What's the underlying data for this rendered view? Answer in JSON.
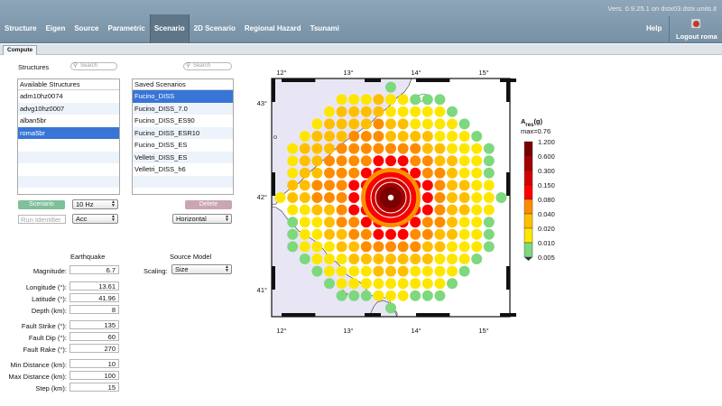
{
  "header": {
    "version": "Vers. 0.9.25.1 on dstx03.dstx.units.it",
    "tabs": [
      "Structure",
      "Eigen",
      "Source",
      "Parametric",
      "Scenario",
      "2D Scenario",
      "Regional Hazard",
      "Tsunami"
    ],
    "active_tab": "Scenario",
    "help": "Help",
    "logout": "Logout roma"
  },
  "subtab": "Compute",
  "structures": {
    "title": "Structures",
    "search_placeholder": "Search",
    "list_header": "Available Structures",
    "items": [
      "adm10hz0074",
      "advg10hz0007",
      "alban5br",
      "roma5br"
    ],
    "selected_index": 3
  },
  "saved": {
    "search_placeholder": "Search",
    "list_header": "Saved Scenarios",
    "items": [
      "Fucino_DISS",
      "Fucino_DISS_7.0",
      "Fucino_DISS_ES90",
      "Fucino_DISS_ESR10",
      "Fucino_DISS_ES",
      "Velletri_DISS_ES",
      "Velletri_DISS_h6"
    ],
    "selected_index": 0
  },
  "controls": {
    "scenario_btn": "Scenario",
    "freq": "10 Hz",
    "run_placeholder": "Run Identifier",
    "component_type": "Acc",
    "delete_btn": "Delete",
    "orientation": "Horizontal"
  },
  "earthquake": {
    "title": "Earthquake",
    "fields": [
      {
        "label": "Magnitude:",
        "value": "6.7"
      },
      {
        "label": "Longitude (°):",
        "value": "13.61"
      },
      {
        "label": "Latitude (°):",
        "value": "41.96"
      },
      {
        "label": "Depth (km):",
        "value": "8"
      },
      {
        "label": "Fault Strike (°):",
        "value": "135"
      },
      {
        "label": "Fault Dip (°):",
        "value": "60"
      },
      {
        "label": "Fault Rake (°):",
        "value": "270"
      },
      {
        "label": "Min Distance (km):",
        "value": "10"
      },
      {
        "label": "Max Distance (km):",
        "value": "100"
      },
      {
        "label": "Step (km):",
        "value": "15"
      }
    ]
  },
  "source_model": {
    "title": "Source Model",
    "scaling_label": "Scaling:",
    "scaling_value": "Size"
  },
  "map": {
    "lon_ticks": [
      "12°",
      "13°",
      "14°",
      "15°"
    ],
    "lat_ticks": [
      "43°",
      "42°",
      "41°"
    ],
    "colorbar_title_main": "A",
    "colorbar_title_sub": "res",
    "colorbar_title_unit": "(g)",
    "colorbar_max": "max=0.76",
    "colorbar_levels": [
      "1.200",
      "0.600",
      "0.300",
      "0.150",
      "0.080",
      "0.040",
      "0.020",
      "0.010",
      "0.005"
    ],
    "colors": {
      "sea": "#e8e6f5",
      "bands": [
        "#7a0000",
        "#a30000",
        "#d40000",
        "#ff0000",
        "#ff8c00",
        "#ffbf00",
        "#ffe600",
        "#7ed87e"
      ]
    }
  }
}
